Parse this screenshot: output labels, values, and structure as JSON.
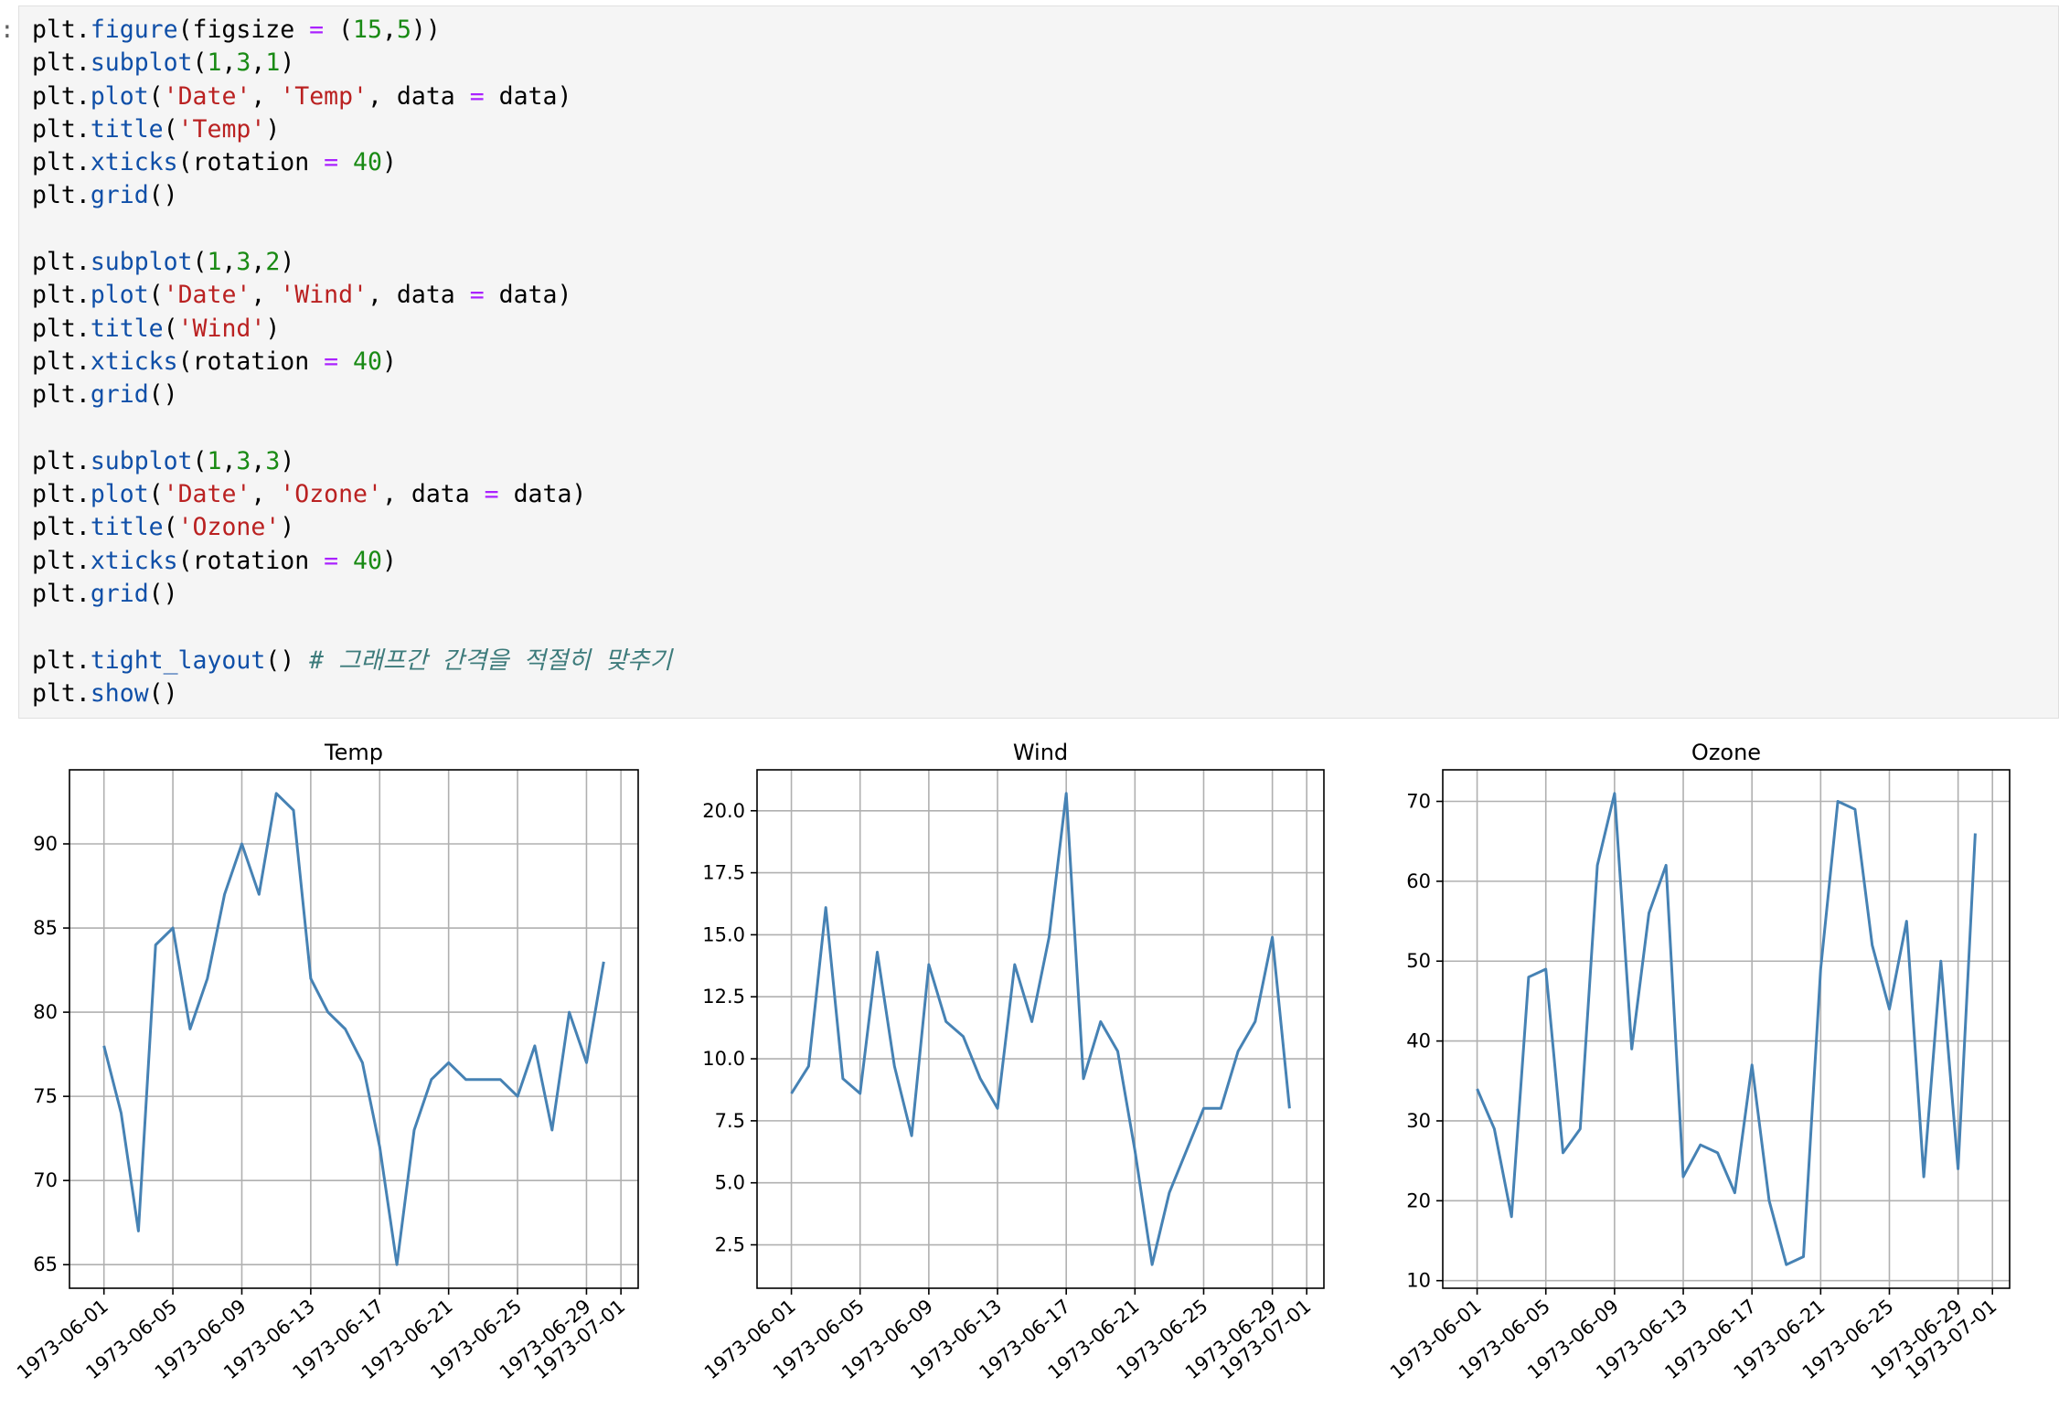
{
  "prompt": ":",
  "code": {
    "lines": [
      [
        [
          "plt.",
          "plain"
        ],
        [
          "figure",
          "fn"
        ],
        [
          "(figsize ",
          "plain"
        ],
        [
          "=",
          "op"
        ],
        [
          " (",
          "plain"
        ],
        [
          "15",
          "num"
        ],
        [
          ",",
          "plain"
        ],
        [
          "5",
          "num"
        ],
        [
          "))",
          "plain"
        ]
      ],
      [
        [
          "plt.",
          "plain"
        ],
        [
          "subplot",
          "fn"
        ],
        [
          "(",
          "plain"
        ],
        [
          "1",
          "num"
        ],
        [
          ",",
          "plain"
        ],
        [
          "3",
          "num"
        ],
        [
          ",",
          "plain"
        ],
        [
          "1",
          "num"
        ],
        [
          ")",
          "plain"
        ]
      ],
      [
        [
          "plt.",
          "plain"
        ],
        [
          "plot",
          "fn"
        ],
        [
          "(",
          "plain"
        ],
        [
          "'Date'",
          "str"
        ],
        [
          ", ",
          "plain"
        ],
        [
          "'Temp'",
          "str"
        ],
        [
          ", data ",
          "plain"
        ],
        [
          "=",
          "op"
        ],
        [
          " data)",
          "plain"
        ]
      ],
      [
        [
          "plt.",
          "plain"
        ],
        [
          "title",
          "fn"
        ],
        [
          "(",
          "plain"
        ],
        [
          "'Temp'",
          "str"
        ],
        [
          ")",
          "plain"
        ]
      ],
      [
        [
          "plt.",
          "plain"
        ],
        [
          "xticks",
          "fn"
        ],
        [
          "(rotation ",
          "plain"
        ],
        [
          "=",
          "op"
        ],
        [
          " ",
          "plain"
        ],
        [
          "40",
          "num"
        ],
        [
          ")",
          "plain"
        ]
      ],
      [
        [
          "plt.",
          "plain"
        ],
        [
          "grid",
          "fn"
        ],
        [
          "()",
          "plain"
        ]
      ],
      [],
      [
        [
          "plt.",
          "plain"
        ],
        [
          "subplot",
          "fn"
        ],
        [
          "(",
          "plain"
        ],
        [
          "1",
          "num"
        ],
        [
          ",",
          "plain"
        ],
        [
          "3",
          "num"
        ],
        [
          ",",
          "plain"
        ],
        [
          "2",
          "num"
        ],
        [
          ")",
          "plain"
        ]
      ],
      [
        [
          "plt.",
          "plain"
        ],
        [
          "plot",
          "fn"
        ],
        [
          "(",
          "plain"
        ],
        [
          "'Date'",
          "str"
        ],
        [
          ", ",
          "plain"
        ],
        [
          "'Wind'",
          "str"
        ],
        [
          ", data ",
          "plain"
        ],
        [
          "=",
          "op"
        ],
        [
          " data)",
          "plain"
        ]
      ],
      [
        [
          "plt.",
          "plain"
        ],
        [
          "title",
          "fn"
        ],
        [
          "(",
          "plain"
        ],
        [
          "'Wind'",
          "str"
        ],
        [
          ")",
          "plain"
        ]
      ],
      [
        [
          "plt.",
          "plain"
        ],
        [
          "xticks",
          "fn"
        ],
        [
          "(rotation ",
          "plain"
        ],
        [
          "=",
          "op"
        ],
        [
          " ",
          "plain"
        ],
        [
          "40",
          "num"
        ],
        [
          ")",
          "plain"
        ]
      ],
      [
        [
          "plt.",
          "plain"
        ],
        [
          "grid",
          "fn"
        ],
        [
          "()",
          "plain"
        ]
      ],
      [],
      [
        [
          "plt.",
          "plain"
        ],
        [
          "subplot",
          "fn"
        ],
        [
          "(",
          "plain"
        ],
        [
          "1",
          "num"
        ],
        [
          ",",
          "plain"
        ],
        [
          "3",
          "num"
        ],
        [
          ",",
          "plain"
        ],
        [
          "3",
          "num"
        ],
        [
          ")",
          "plain"
        ]
      ],
      [
        [
          "plt.",
          "plain"
        ],
        [
          "plot",
          "fn"
        ],
        [
          "(",
          "plain"
        ],
        [
          "'Date'",
          "str"
        ],
        [
          ", ",
          "plain"
        ],
        [
          "'Ozone'",
          "str"
        ],
        [
          ", data ",
          "plain"
        ],
        [
          "=",
          "op"
        ],
        [
          " data)",
          "plain"
        ]
      ],
      [
        [
          "plt.",
          "plain"
        ],
        [
          "title",
          "fn"
        ],
        [
          "(",
          "plain"
        ],
        [
          "'Ozone'",
          "str"
        ],
        [
          ")",
          "plain"
        ]
      ],
      [
        [
          "plt.",
          "plain"
        ],
        [
          "xticks",
          "fn"
        ],
        [
          "(rotation ",
          "plain"
        ],
        [
          "=",
          "op"
        ],
        [
          " ",
          "plain"
        ],
        [
          "40",
          "num"
        ],
        [
          ")",
          "plain"
        ]
      ],
      [
        [
          "plt.",
          "plain"
        ],
        [
          "grid",
          "fn"
        ],
        [
          "()",
          "plain"
        ]
      ],
      [],
      [
        [
          "plt.",
          "plain"
        ],
        [
          "tight_layout",
          "fn"
        ],
        [
          "() ",
          "plain"
        ],
        [
          "# 그래프간 간격을 적절히 맞추기",
          "com"
        ]
      ],
      [
        [
          "plt.",
          "plain"
        ],
        [
          "show",
          "fn"
        ],
        [
          "()",
          "plain"
        ]
      ]
    ]
  },
  "chart_data": [
    {
      "type": "line",
      "title": "Temp",
      "xlabel": "",
      "ylabel": "",
      "grid": true,
      "line_color": "#4682b4",
      "x": [
        "1973-06-01",
        "1973-06-02",
        "1973-06-03",
        "1973-06-04",
        "1973-06-05",
        "1973-06-06",
        "1973-06-07",
        "1973-06-08",
        "1973-06-09",
        "1973-06-10",
        "1973-06-11",
        "1973-06-12",
        "1973-06-13",
        "1973-06-14",
        "1973-06-15",
        "1973-06-16",
        "1973-06-17",
        "1973-06-18",
        "1973-06-19",
        "1973-06-20",
        "1973-06-21",
        "1973-06-22",
        "1973-06-23",
        "1973-06-24",
        "1973-06-25",
        "1973-06-26",
        "1973-06-27",
        "1973-06-28",
        "1973-06-29",
        "1973-06-30"
      ],
      "values": [
        78,
        74,
        67,
        84,
        85,
        79,
        82,
        87,
        90,
        87,
        93,
        92,
        82,
        80,
        79,
        77,
        72,
        65,
        73,
        76,
        77,
        76,
        76,
        76,
        75,
        78,
        73,
        80,
        77,
        83
      ],
      "xlim": [
        "1973-05-30",
        "1973-07-02"
      ],
      "ylim": [
        63.6,
        94.4
      ],
      "xticks": [
        "1973-06-01",
        "1973-06-05",
        "1973-06-09",
        "1973-06-13",
        "1973-06-17",
        "1973-06-21",
        "1973-06-25",
        "1973-06-29",
        "1973-07-01"
      ],
      "yticks": [
        65,
        70,
        75,
        80,
        85,
        90
      ],
      "ytick_labels": [
        "65",
        "70",
        "75",
        "80",
        "85",
        "90"
      ],
      "xtick_rotation": 40
    },
    {
      "type": "line",
      "title": "Wind",
      "xlabel": "",
      "ylabel": "",
      "grid": true,
      "line_color": "#4682b4",
      "x": [
        "1973-06-01",
        "1973-06-02",
        "1973-06-03",
        "1973-06-04",
        "1973-06-05",
        "1973-06-06",
        "1973-06-07",
        "1973-06-08",
        "1973-06-09",
        "1973-06-10",
        "1973-06-11",
        "1973-06-12",
        "1973-06-13",
        "1973-06-14",
        "1973-06-15",
        "1973-06-16",
        "1973-06-17",
        "1973-06-18",
        "1973-06-19",
        "1973-06-20",
        "1973-06-21",
        "1973-06-22",
        "1973-06-23",
        "1973-06-24",
        "1973-06-25",
        "1973-06-26",
        "1973-06-27",
        "1973-06-28",
        "1973-06-29",
        "1973-06-30"
      ],
      "values": [
        8.6,
        9.7,
        16.1,
        9.2,
        8.6,
        14.3,
        9.7,
        6.9,
        13.8,
        11.5,
        10.9,
        9.2,
        8.0,
        13.8,
        11.5,
        14.9,
        20.7,
        9.2,
        11.5,
        10.3,
        6.3,
        1.7,
        4.6,
        6.3,
        8.0,
        8.0,
        10.3,
        11.5,
        14.9,
        8.0
      ],
      "xlim": [
        "1973-05-30",
        "1973-07-02"
      ],
      "ylim": [
        0.75,
        21.65
      ],
      "xticks": [
        "1973-06-01",
        "1973-06-05",
        "1973-06-09",
        "1973-06-13",
        "1973-06-17",
        "1973-06-21",
        "1973-06-25",
        "1973-06-29",
        "1973-07-01"
      ],
      "yticks": [
        2.5,
        5.0,
        7.5,
        10.0,
        12.5,
        15.0,
        17.5,
        20.0
      ],
      "ytick_labels": [
        "2.5",
        "5.0",
        "7.5",
        "10.0",
        "12.5",
        "15.0",
        "17.5",
        "20.0"
      ],
      "xtick_rotation": 40
    },
    {
      "type": "line",
      "title": "Ozone",
      "xlabel": "",
      "ylabel": "",
      "grid": true,
      "line_color": "#4682b4",
      "x": [
        "1973-06-01",
        "1973-06-02",
        "1973-06-03",
        "1973-06-04",
        "1973-06-05",
        "1973-06-06",
        "1973-06-07",
        "1973-06-08",
        "1973-06-09",
        "1973-06-10",
        "1973-06-11",
        "1973-06-12",
        "1973-06-13",
        "1973-06-14",
        "1973-06-15",
        "1973-06-16",
        "1973-06-17",
        "1973-06-18",
        "1973-06-19",
        "1973-06-20",
        "1973-06-21",
        "1973-06-22",
        "1973-06-23",
        "1973-06-24",
        "1973-06-25",
        "1973-06-26",
        "1973-06-27",
        "1973-06-28",
        "1973-06-29",
        "1973-06-30"
      ],
      "values": [
        34,
        29,
        18,
        48,
        49,
        26,
        29,
        62,
        71,
        39,
        56,
        62,
        23,
        27,
        26,
        21,
        37,
        20,
        12,
        13,
        49,
        70,
        69,
        52,
        44,
        55,
        23,
        50,
        24,
        66
      ],
      "xlim": [
        "1973-05-30",
        "1973-07-02"
      ],
      "ylim": [
        9.05,
        73.95
      ],
      "xticks": [
        "1973-06-01",
        "1973-06-05",
        "1973-06-09",
        "1973-06-13",
        "1973-06-17",
        "1973-06-21",
        "1973-06-25",
        "1973-06-29",
        "1973-07-01"
      ],
      "yticks": [
        10,
        20,
        30,
        40,
        50,
        60,
        70
      ],
      "ytick_labels": [
        "10",
        "20",
        "30",
        "40",
        "50",
        "60",
        "70"
      ],
      "xtick_rotation": 40
    }
  ]
}
